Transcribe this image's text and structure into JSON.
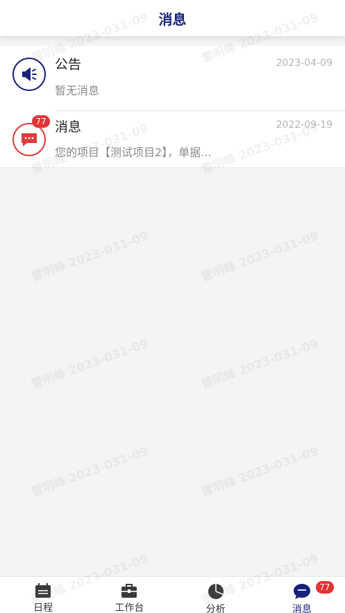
{
  "header": {
    "title": "消息"
  },
  "messages": [
    {
      "title": "公告",
      "date": "2023-04-09",
      "subtitle": "暂无消息",
      "icon": "megaphone-icon",
      "icon_color": "#17207a"
    },
    {
      "title": "消息",
      "date": "2022-09-19",
      "subtitle": "您的项目【测试项目2】，单据...",
      "icon": "chat-bubble-icon",
      "icon_color": "#e23a3a",
      "badge": "77"
    }
  ],
  "watermark": {
    "text": "雷明峰 2023-031-09"
  },
  "tabbar": {
    "tabs": [
      {
        "label": "日程",
        "icon": "calendar-icon",
        "active": false
      },
      {
        "label": "工作台",
        "icon": "briefcase-icon",
        "active": false
      },
      {
        "label": "分析",
        "icon": "pie-chart-icon",
        "active": false
      },
      {
        "label": "消息",
        "icon": "message-icon",
        "active": true,
        "badge": "77"
      }
    ]
  },
  "colors": {
    "accent": "#17207a",
    "badge": "#e03434",
    "background": "#f4f4f4"
  }
}
